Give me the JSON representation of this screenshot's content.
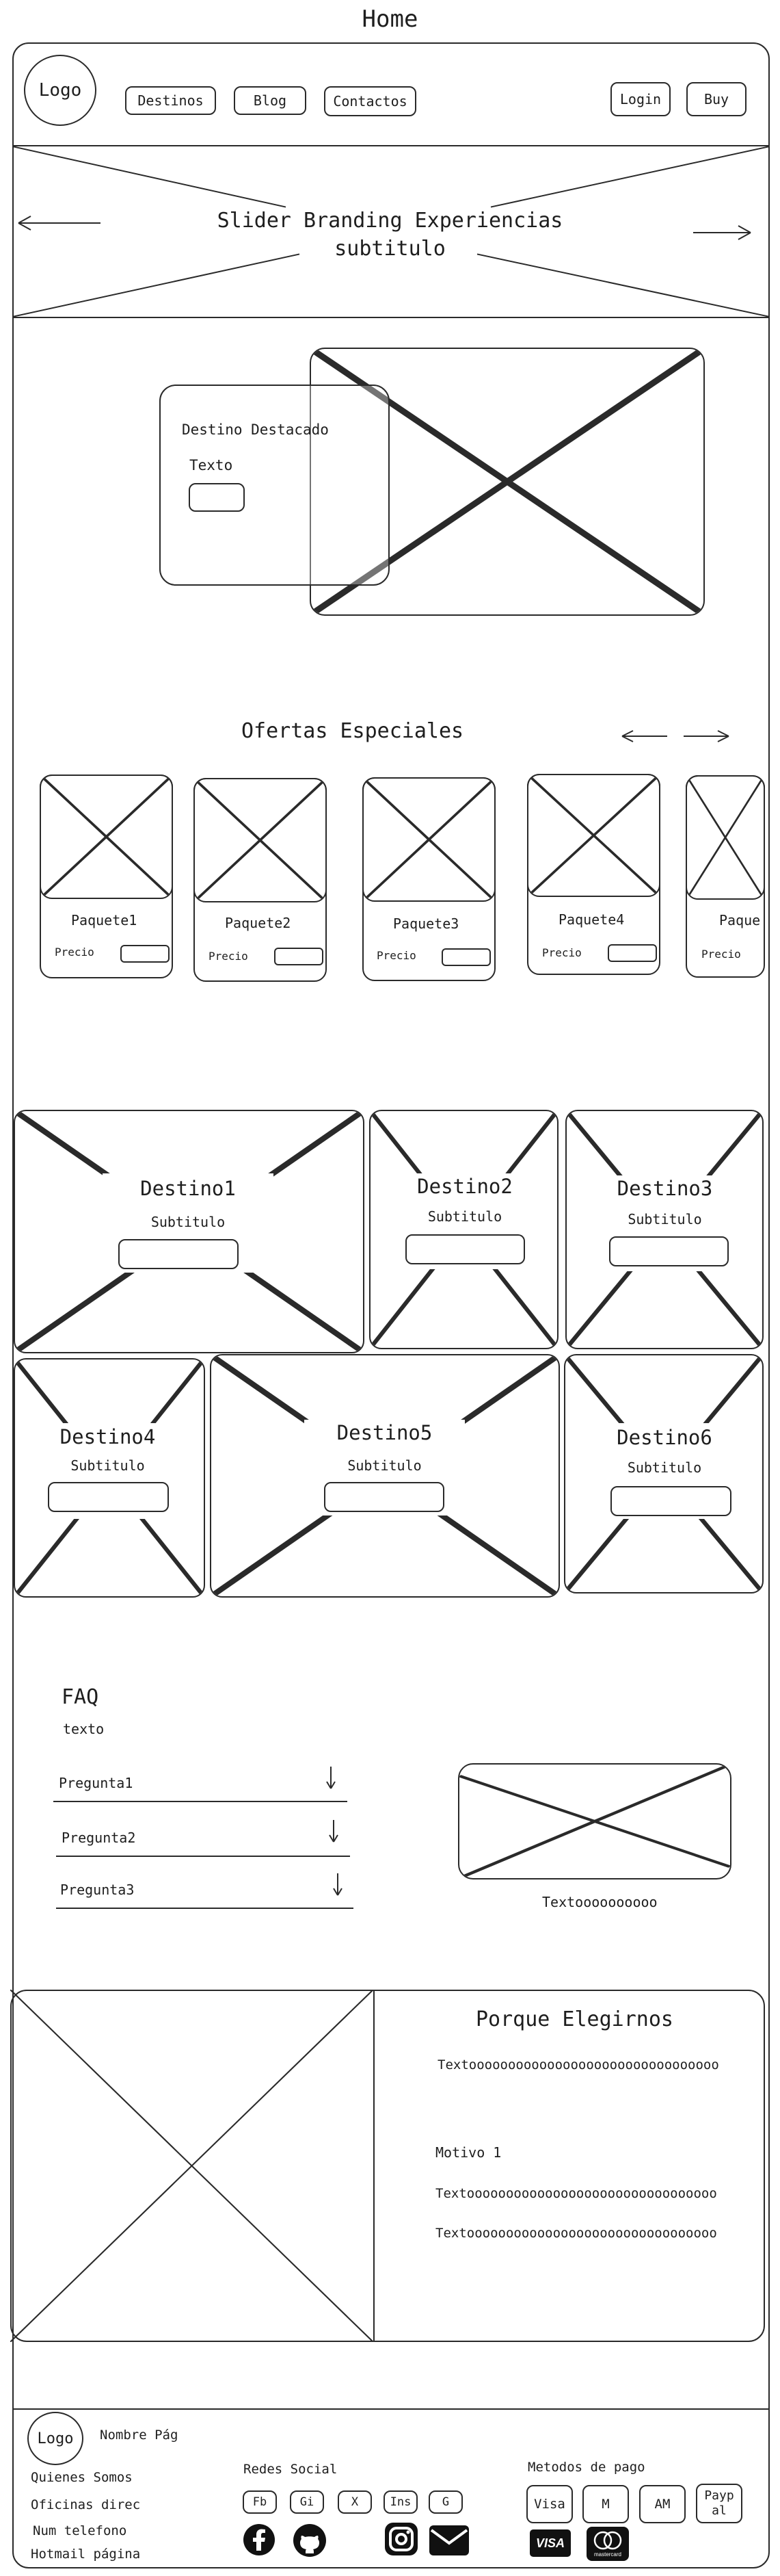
{
  "page": {
    "title": "Home"
  },
  "header": {
    "logo": "Logo",
    "nav": [
      "Destinos",
      "Blog",
      "Contactos"
    ],
    "login": "Login",
    "buy": "Buy"
  },
  "hero": {
    "title": "Slider Branding Experiencias",
    "subtitle": "subtitulo"
  },
  "featured": {
    "title": "Destino Destacado",
    "text": "Texto"
  },
  "offers": {
    "title": "Ofertas Especiales",
    "packages": [
      {
        "name": "Paquete1",
        "price": "Precio"
      },
      {
        "name": "Paquete2",
        "price": "Precio"
      },
      {
        "name": "Paquete3",
        "price": "Precio"
      },
      {
        "name": "Paquete4",
        "price": "Precio"
      },
      {
        "name": "Paque",
        "price": "Precio"
      }
    ]
  },
  "destinations": [
    {
      "name": "Destino1",
      "subtitle": "Subtitulo"
    },
    {
      "name": "Destino2",
      "subtitle": "Subtitulo"
    },
    {
      "name": "Destino3",
      "subtitle": "Subtitulo"
    },
    {
      "name": "Destino4",
      "subtitle": "Subtitulo"
    },
    {
      "name": "Destino5",
      "subtitle": "Subtitulo"
    },
    {
      "name": "Destino6",
      "subtitle": "Subtitulo"
    }
  ],
  "faq": {
    "title": "FAQ",
    "text": "texto",
    "questions": [
      "Pregunta1",
      "Pregunta2",
      "Pregunta3"
    ],
    "image_caption": "Textoooooooooo"
  },
  "why": {
    "title": "Porque Elegirnos",
    "text1": "Textoooooooooooooooooooooooooooooooo",
    "motive": "Motivo 1",
    "text2": "Textoooooooooooooooooooooooooooooooo",
    "text3": "Textoooooooooooooooooooooooooooooooo"
  },
  "footer": {
    "logo": "Logo",
    "page_name": "Nombre Pág",
    "links": [
      "Quienes Somos",
      "Oficinas direc",
      "Num telefono",
      "Hotmail página"
    ],
    "social_title": "Redes Social",
    "social": [
      "Fb",
      "Gi",
      "X",
      "Ins",
      "G"
    ],
    "payment_title": "Metodos de pago",
    "payments": [
      "Visa",
      "M",
      "AM",
      "Paypal"
    ],
    "visa_logo": "VISA",
    "mastercard_logo": "mastercard"
  }
}
